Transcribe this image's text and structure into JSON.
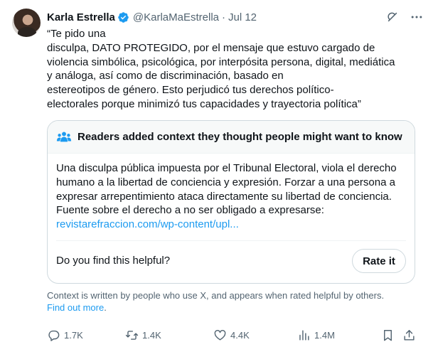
{
  "tweet": {
    "author_name": "Karla Estrella",
    "handle": "@KarlaMaEstrella",
    "separator": "·",
    "date": "Jul 12",
    "text_lines": [
      "“Te pido una",
      "disculpa, DATO PROTEGIDO, por el mensaje que estuvo cargado de",
      "violencia simbólica, psicológica, por interpósita persona, digital, mediática",
      "y análoga, así como de discriminación, basado en",
      "estereotipos de género. Esto perjudicó tus derechos político-",
      "electorales porque minimizó tus capacidades y trayectoria política”"
    ]
  },
  "community_note": {
    "title": "Readers added context they thought people might want to know",
    "body_lines": [
      "Una disculpa pública impuesta por el Tribunal Electoral, viola el derecho",
      "humano a la libertad de conciencia y expresión. Forzar a una persona a",
      "expresar arrepentimiento ataca directamente su libertad de conciencia.",
      "Fuente sobre el derecho a no ser obligado a expresarse:"
    ],
    "link": "revistarefraccion.com/wp-content/upl...",
    "helpful_question": "Do you find this helpful?",
    "rate_button": "Rate it"
  },
  "context_disclaimer": "Context is written by people who use X, and appears when rated helpful by others.",
  "find_out_more": "Find out more",
  "find_out_more_suffix": ".",
  "actions": {
    "replies": "1.7K",
    "reposts": "1.4K",
    "likes": "4.4K",
    "views": "1.4M"
  },
  "colors": {
    "accent": "#1d9bf0",
    "secondary_text": "#536471",
    "border": "#cfd9de"
  },
  "icons": [
    "verified-badge-icon",
    "grok-icon",
    "more-icon",
    "community-notes-icon",
    "reply-icon",
    "repost-icon",
    "like-icon",
    "views-icon",
    "bookmark-icon",
    "share-icon"
  ]
}
